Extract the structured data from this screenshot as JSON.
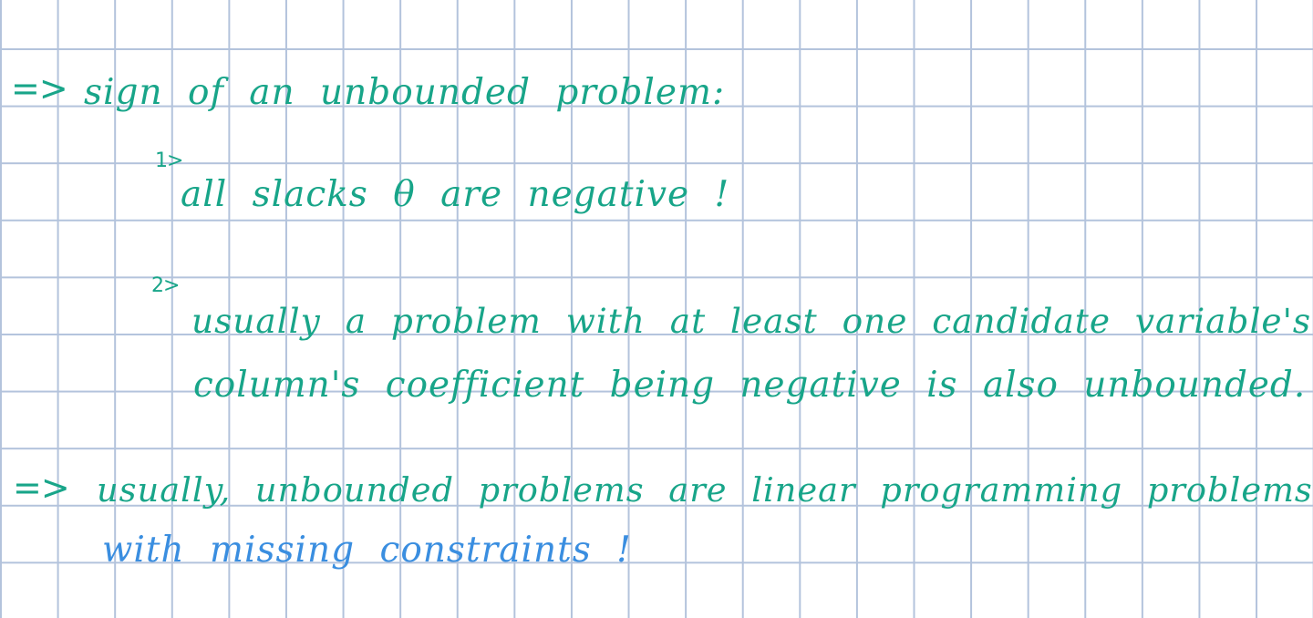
{
  "colors": {
    "ink_green": "#18a589",
    "ink_blue": "#3a8ee0",
    "grid": "#b3c3dc",
    "paper": "#ffffff"
  },
  "notes": {
    "arrow_1": "=>",
    "line_1": "sign of an unbounded problem:",
    "marker_1": "1>",
    "line_2": "all slacks θ are negative !",
    "marker_2": "2>",
    "line_3a": "usually a problem with at least one candidate variable's",
    "line_3b": "column's coefficient being negative is also unbounded.",
    "arrow_2": "=>",
    "line_4a": "usually, unbounded problems are linear programming problems",
    "line_4b": "with missing constraints !"
  }
}
